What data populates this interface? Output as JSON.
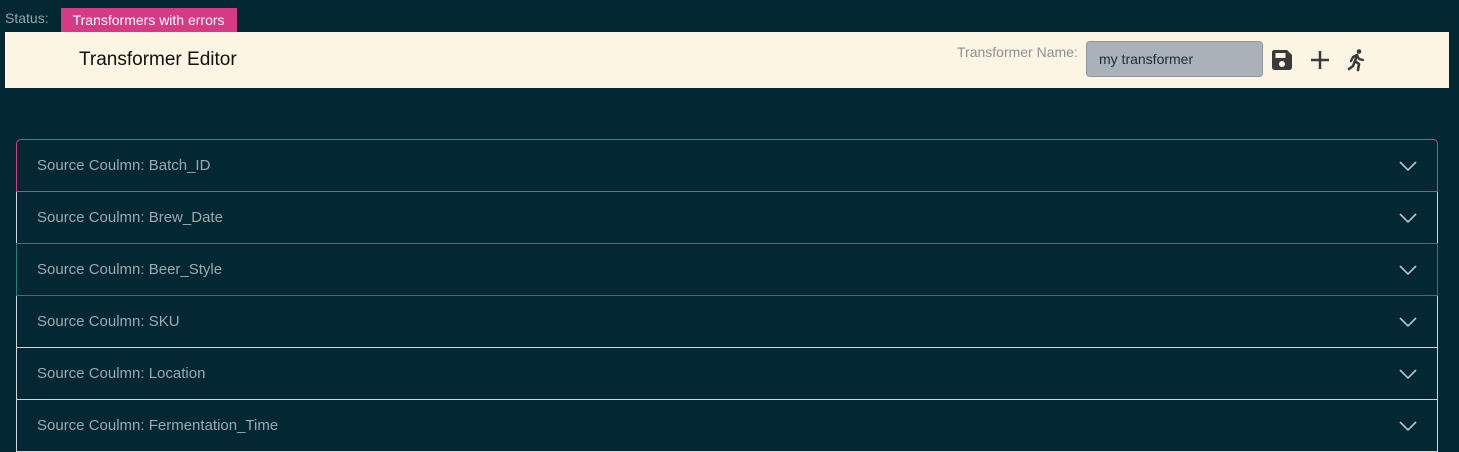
{
  "status": {
    "label": "Status:",
    "badge": "Transformers with errors",
    "badge_color": "#d63a85"
  },
  "header": {
    "title": "Transformer Editor",
    "name_label": "Transformer Name:",
    "name_value": "my transformer",
    "icons": [
      "save-icon",
      "plus-icon",
      "run-icon"
    ]
  },
  "columns": [
    {
      "label": "Source Coulmn: Batch_ID"
    },
    {
      "label": "Source Coulmn: Brew_Date"
    },
    {
      "label": "Source Coulmn: Beer_Style"
    },
    {
      "label": "Source Coulmn: SKU"
    },
    {
      "label": "Source Coulmn: Location"
    },
    {
      "label": "Source Coulmn: Fermentation_Time"
    }
  ],
  "colors": {
    "background": "#032733",
    "header_bg": "#fdf5e3",
    "error_border": "#d63a85",
    "focus_border": "#1f7e7c"
  }
}
